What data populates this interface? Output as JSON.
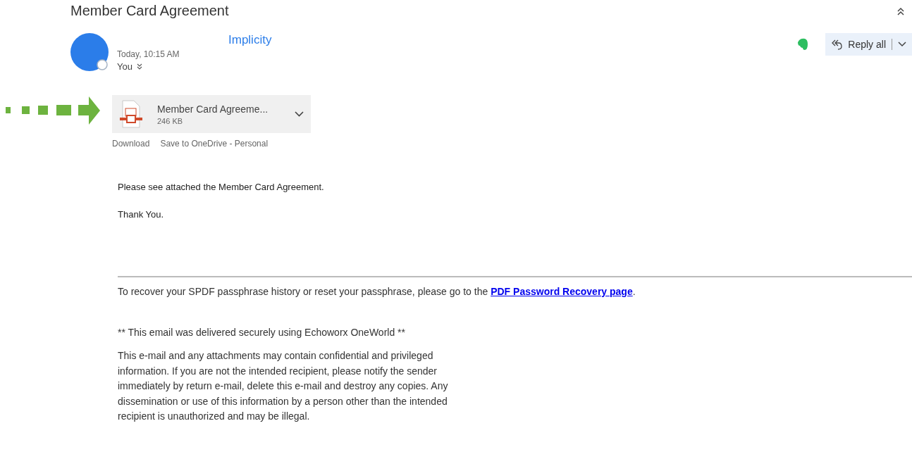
{
  "subject": "Member Card Agreement",
  "sender": {
    "name": "Implicity",
    "time": "Today, 10:15 AM",
    "to": "You"
  },
  "reply": {
    "label": "Reply all"
  },
  "attachment": {
    "name": "Member Card Agreeme...",
    "size": "246 KB",
    "actions": [
      "Download",
      "Save to OneDrive - Personal"
    ]
  },
  "body": [
    "Please see attached the Member Card Agreement.",
    "Thank You."
  ],
  "footer": {
    "recovery_text": "To recover your SPDF passphrase history or reset your passphrase, please go to the ",
    "recovery_link": "PDF Password Recovery page",
    "recovery_end": ".",
    "delivered": "** This email was delivered securely using Echoworx OneWorld **",
    "disclaimer": "This e-mail and any attachments may contain confidential and privileged information. If you are not the intended recipient, please notify the sender immediately by return e-mail, delete this e-mail and destroy any copies. Any dissemination or use of this information by a person other than the intended recipient is unauthorized and may be illegal."
  }
}
